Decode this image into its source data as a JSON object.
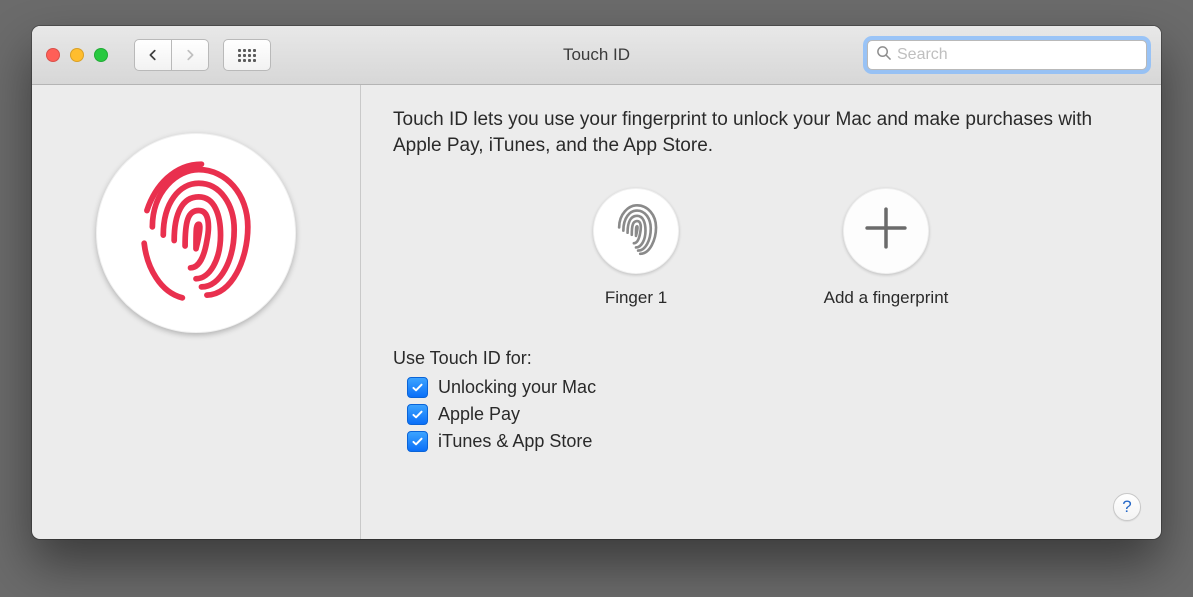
{
  "window": {
    "title": "Touch ID"
  },
  "search": {
    "placeholder": "Search",
    "value": ""
  },
  "intro": "Touch ID lets you use your fingerprint to unlock your Mac and make purchases with Apple Pay, iTunes, and the App Store.",
  "fingers": {
    "finger1_label": "Finger 1",
    "add_label": "Add a fingerprint"
  },
  "use_section": {
    "heading": "Use Touch ID for:",
    "options": [
      {
        "label": "Unlocking your Mac",
        "checked": true
      },
      {
        "label": "Apple Pay",
        "checked": true
      },
      {
        "label": "iTunes & App Store",
        "checked": true
      }
    ]
  },
  "help": "?"
}
